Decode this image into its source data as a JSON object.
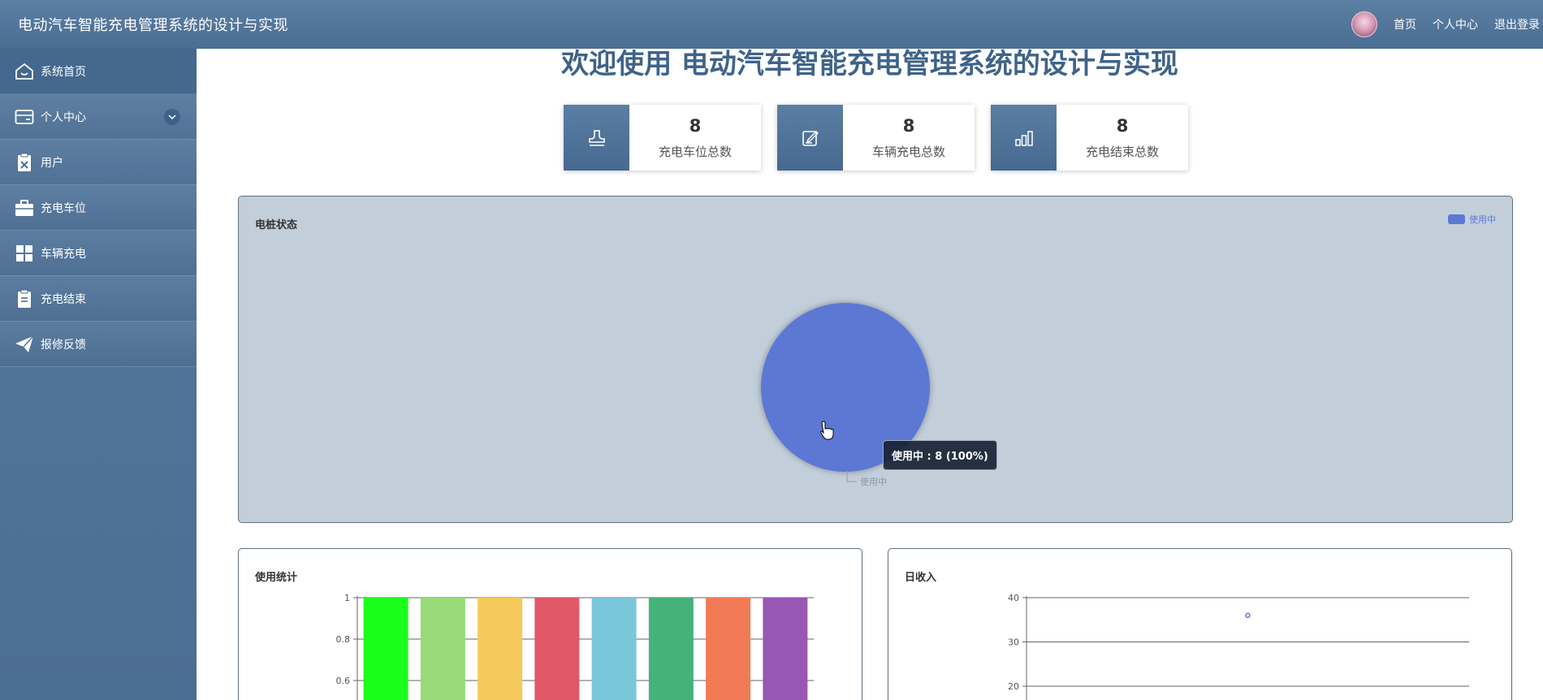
{
  "header": {
    "title": "电动汽车智能充电管理系统的设计与实现",
    "links": {
      "home": "首页",
      "profile": "个人中心",
      "logout": "退出登录"
    }
  },
  "sidebar": {
    "items": [
      {
        "label": "系统首页",
        "icon": "home-icon"
      },
      {
        "label": "个人中心",
        "icon": "wallet-icon"
      },
      {
        "label": "用户",
        "icon": "clipboard-x-icon"
      },
      {
        "label": "充电车位",
        "icon": "briefcase-icon"
      },
      {
        "label": "车辆充电",
        "icon": "grid-icon"
      },
      {
        "label": "充电结束",
        "icon": "clipboard-icon"
      },
      {
        "label": "报修反馈",
        "icon": "paper-plane-icon"
      }
    ]
  },
  "welcome": "欢迎使用 电动汽车智能充电管理系统的设计与实现",
  "stats": [
    {
      "value": "8",
      "label": "充电车位总数",
      "icon": "stamp-icon"
    },
    {
      "value": "8",
      "label": "车辆充电总数",
      "icon": "edit-icon"
    },
    {
      "value": "8",
      "label": "充电结束总数",
      "icon": "bar-chart-icon"
    }
  ],
  "colors": {
    "accent": "#4a6d93",
    "pie": "#5b78d4",
    "panel_bg": "#c2cfdb"
  },
  "chart_data": [
    {
      "type": "pie",
      "title": "电桩状态",
      "categories": [
        "使用中"
      ],
      "values": [
        8
      ],
      "legend": [
        "使用中"
      ],
      "legend_position": "top-right",
      "slice_label": "使用中",
      "tooltip": "使用中 : 8 (100%)"
    },
    {
      "type": "bar",
      "title": "使用统计",
      "categories": [
        "",
        "",
        "",
        "",
        "",
        "",
        "",
        ""
      ],
      "values": [
        1,
        1,
        1,
        1,
        1,
        1,
        1,
        1
      ],
      "colors": [
        "#1aff1a",
        "#98db78",
        "#f5c95c",
        "#e15868",
        "#7ac7dc",
        "#45b27a",
        "#f27b55",
        "#9757b3"
      ],
      "yticks": [
        "1",
        "0.8",
        "0.6"
      ],
      "ylim": [
        0,
        1
      ]
    },
    {
      "type": "line",
      "title": "日收入",
      "points": [
        {
          "x": 0.5,
          "y": 36
        }
      ],
      "yticks": [
        "40",
        "30",
        "20"
      ],
      "ylim": [
        0,
        40
      ]
    }
  ]
}
